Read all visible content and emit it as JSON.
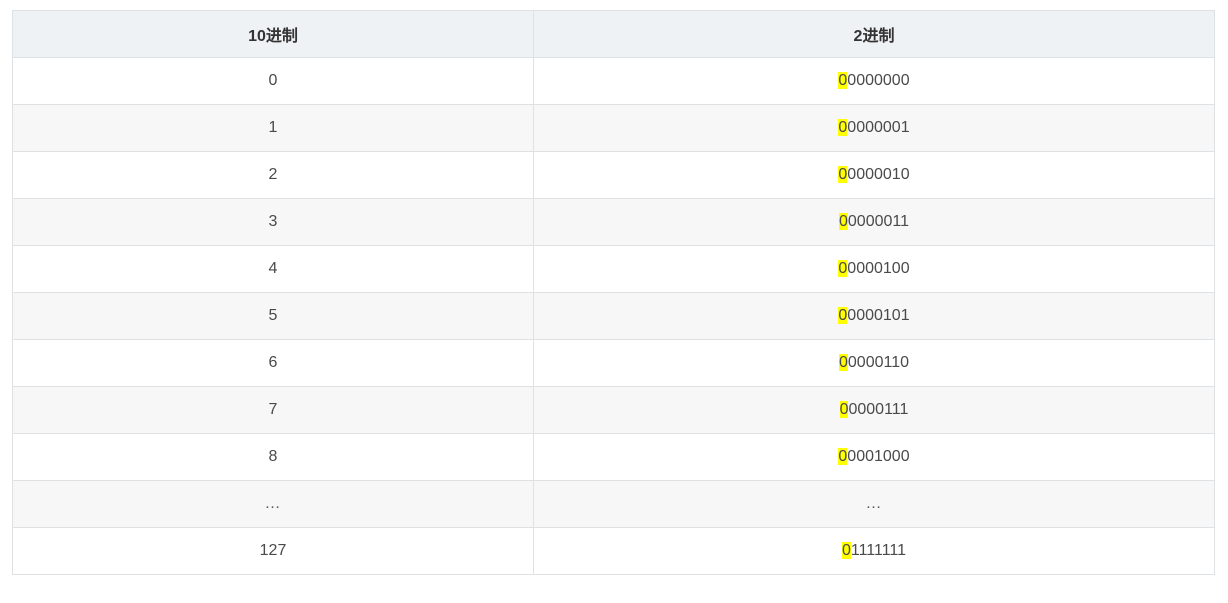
{
  "table": {
    "headers": [
      "10进制",
      "2进制"
    ],
    "highlight_color": "#ffff00",
    "rows": [
      {
        "decimal": "0",
        "bin_first": "0",
        "bin_rest": "0000000"
      },
      {
        "decimal": "1",
        "bin_first": "0",
        "bin_rest": "0000001"
      },
      {
        "decimal": "2",
        "bin_first": "0",
        "bin_rest": "0000010"
      },
      {
        "decimal": "3",
        "bin_first": "0",
        "bin_rest": "0000011"
      },
      {
        "decimal": "4",
        "bin_first": "0",
        "bin_rest": "0000100"
      },
      {
        "decimal": "5",
        "bin_first": "0",
        "bin_rest": "0000101"
      },
      {
        "decimal": "6",
        "bin_first": "0",
        "bin_rest": "0000110"
      },
      {
        "decimal": "7",
        "bin_first": "0",
        "bin_rest": "0000111"
      },
      {
        "decimal": "8",
        "bin_first": "0",
        "bin_rest": "0001000"
      },
      {
        "decimal": "…",
        "bin_first": "",
        "bin_rest": "…"
      },
      {
        "decimal": "127",
        "bin_first": "0",
        "bin_rest": "1111111"
      }
    ]
  }
}
